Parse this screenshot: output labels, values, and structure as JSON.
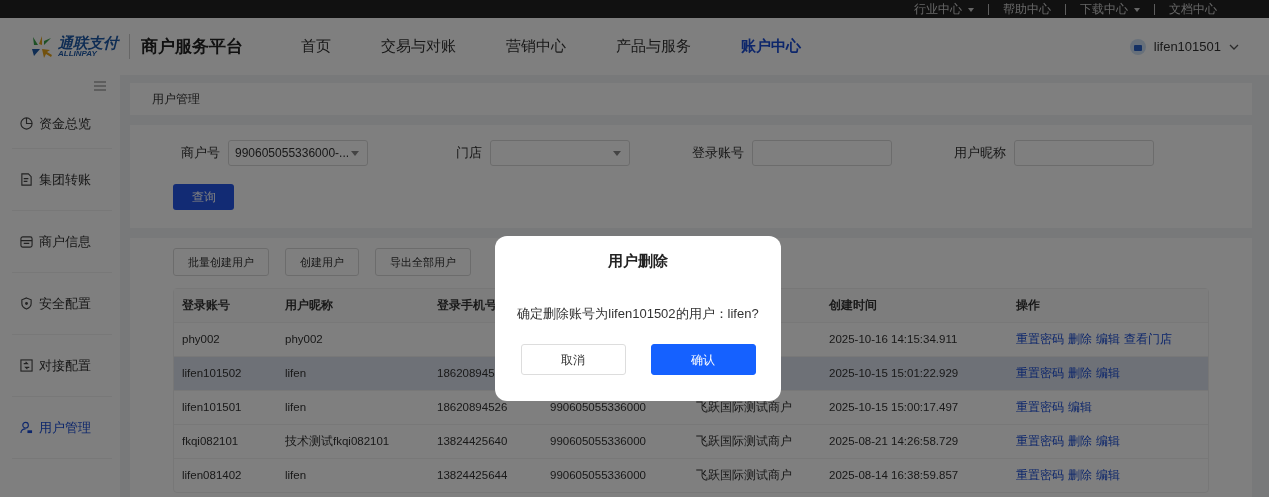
{
  "top_links": [
    {
      "label": "行业中心",
      "dropdown": true
    },
    {
      "label": "帮助中心",
      "dropdown": false
    },
    {
      "label": "下载中心",
      "dropdown": true
    },
    {
      "label": "文档中心",
      "dropdown": false
    }
  ],
  "header": {
    "logo_text": "通联支付",
    "logo_subtext": "ALLINPAY",
    "platform_title": "商户服务平台",
    "nav": [
      {
        "label": "首页",
        "selected": false
      },
      {
        "label": "交易与对账",
        "selected": false
      },
      {
        "label": "营销中心",
        "selected": false
      },
      {
        "label": "产品与服务",
        "selected": false
      },
      {
        "label": "账户中心",
        "selected": true
      }
    ],
    "user": {
      "name": "lifen101501"
    }
  },
  "sidebar": {
    "items": [
      {
        "label": "资金总览",
        "selected": false
      },
      {
        "label": "集团转账",
        "selected": false
      },
      {
        "label": "商户信息",
        "selected": false
      },
      {
        "label": "安全配置",
        "selected": false
      },
      {
        "label": "对接配置",
        "selected": false
      },
      {
        "label": "用户管理",
        "selected": true
      }
    ]
  },
  "breadcrumb": "用户管理",
  "filters": [
    {
      "label": "商户号",
      "kind": "select",
      "value": "990605055336000-..."
    },
    {
      "label": "门店",
      "kind": "select"
    },
    {
      "label": "登录账号",
      "kind": "input"
    },
    {
      "label": "用户昵称",
      "kind": "input"
    }
  ],
  "query_button": "查询",
  "toolbar_buttons": [
    "批量创建用户",
    "创建用户",
    "导出全部用户"
  ],
  "table": {
    "columns": [
      "登录账号",
      "用户昵称",
      "登录手机号",
      null,
      null,
      "创建时间",
      "操作"
    ],
    "rows": [
      {
        "selected": false,
        "cells": [
          "phy002",
          "phy002",
          null,
          null,
          null,
          "2025-10-16 14:15:34.911"
        ],
        "actions": [
          "重置密码",
          "删除",
          "编辑",
          "查看门店"
        ]
      },
      {
        "selected": true,
        "cells": [
          "lifen101502",
          "lifen",
          "186208945",
          null,
          null,
          "2025-10-15 15:01:22.929"
        ],
        "actions": [
          "重置密码",
          "删除",
          "编辑"
        ]
      },
      {
        "selected": false,
        "cells": [
          "lifen101501",
          "lifen",
          "18620894526",
          "990605055336000",
          "飞跃国际测试商户",
          "2025-10-15 15:00:17.497"
        ],
        "actions": [
          "重置密码",
          "编辑"
        ]
      },
      {
        "selected": false,
        "cells": [
          "fkqi082101",
          "技术测试fkqi082101",
          "13824425640",
          "990605055336000",
          "飞跃国际测试商户",
          "2025-08-21 14:26:58.729"
        ],
        "actions": [
          "重置密码",
          "删除",
          "编辑"
        ]
      },
      {
        "selected": false,
        "cells": [
          "lifen081402",
          "lifen",
          "13824425644",
          "990605055336000",
          "飞跃国际测试商户",
          "2025-08-14 16:38:59.857"
        ],
        "actions": [
          "重置密码",
          "删除",
          "编辑"
        ]
      }
    ]
  },
  "modal": {
    "title": "用户删除",
    "message": "确定删除账号为lifen101502的用户：lifen?",
    "buttons": [
      {
        "label": "取消",
        "kind": "secondary"
      },
      {
        "label": "确认",
        "kind": "primary"
      }
    ]
  }
}
